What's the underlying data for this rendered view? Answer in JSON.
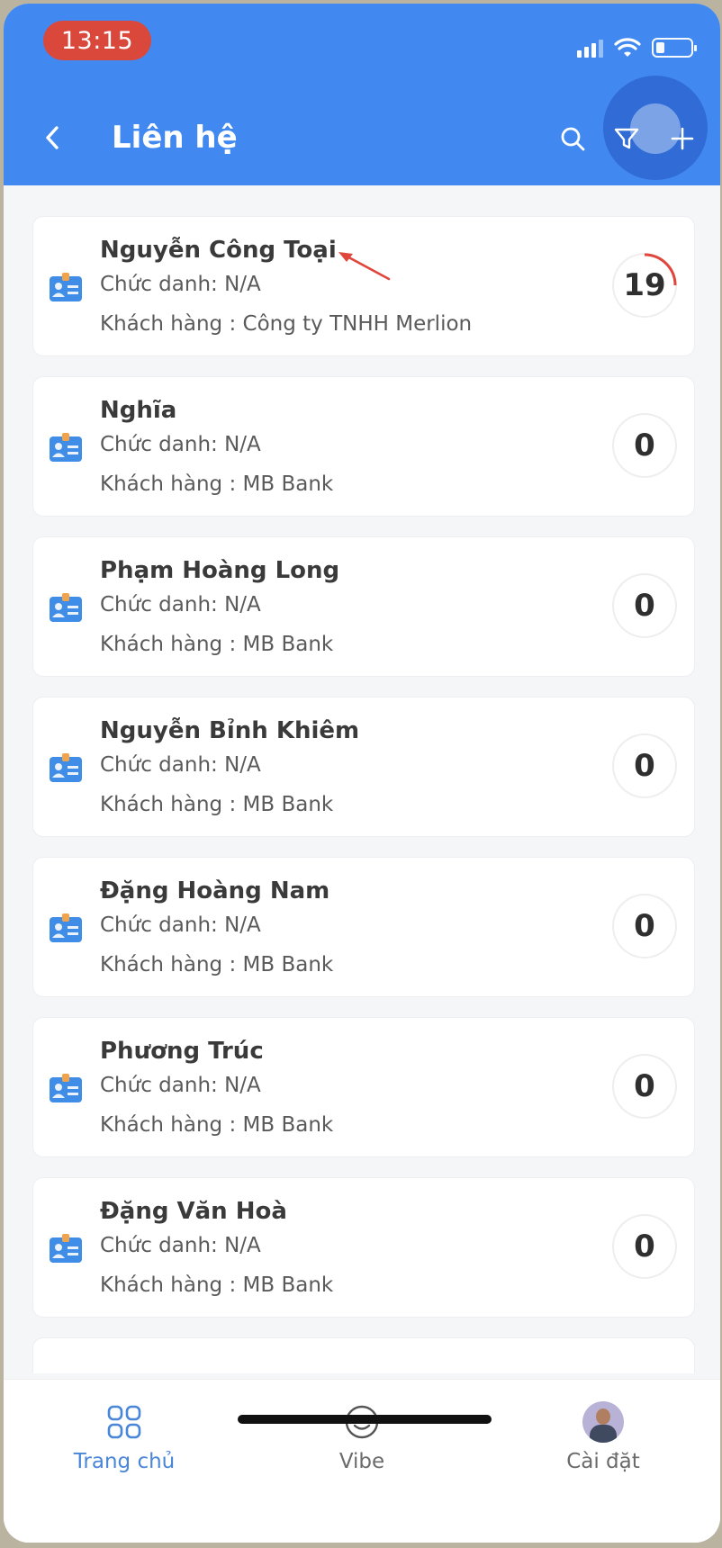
{
  "status_bar": {
    "time": "13:15"
  },
  "header": {
    "title": "Liên hệ"
  },
  "contacts": [
    {
      "name": "Nguyễn Công Toại",
      "role": "Chức danh: N/A",
      "customer": "Khách hàng : Công ty TNHH Merlion",
      "count": "19"
    },
    {
      "name": "Nghĩa",
      "role": "Chức danh: N/A",
      "customer": "Khách hàng : MB Bank",
      "count": "0"
    },
    {
      "name": "Phạm Hoàng Long",
      "role": "Chức danh: N/A",
      "customer": "Khách hàng : MB Bank",
      "count": "0"
    },
    {
      "name": "Nguyễn Bỉnh Khiêm",
      "role": "Chức danh: N/A",
      "customer": "Khách hàng : MB Bank",
      "count": "0"
    },
    {
      "name": "Đặng Hoàng Nam",
      "role": "Chức danh: N/A",
      "customer": "Khách hàng : MB Bank",
      "count": "0"
    },
    {
      "name": "Phương Trúc",
      "role": "Chức danh: N/A",
      "customer": "Khách hàng : MB Bank",
      "count": "0"
    },
    {
      "name": "Đặng Văn Hoà",
      "role": "Chức danh: N/A",
      "customer": "Khách hàng : MB Bank",
      "count": "0"
    }
  ],
  "bottom_nav": [
    {
      "label": "Trang chủ",
      "icon": "grid-icon",
      "active": true
    },
    {
      "label": "Vibe",
      "icon": "smiley-icon",
      "active": false
    },
    {
      "label": "Cài đặt",
      "icon": "avatar",
      "active": false
    }
  ],
  "colors": {
    "header": "#4189f0",
    "accent": "#4a86d8",
    "time_pill": "#d9483b",
    "progress_arc": "#e0463c"
  }
}
